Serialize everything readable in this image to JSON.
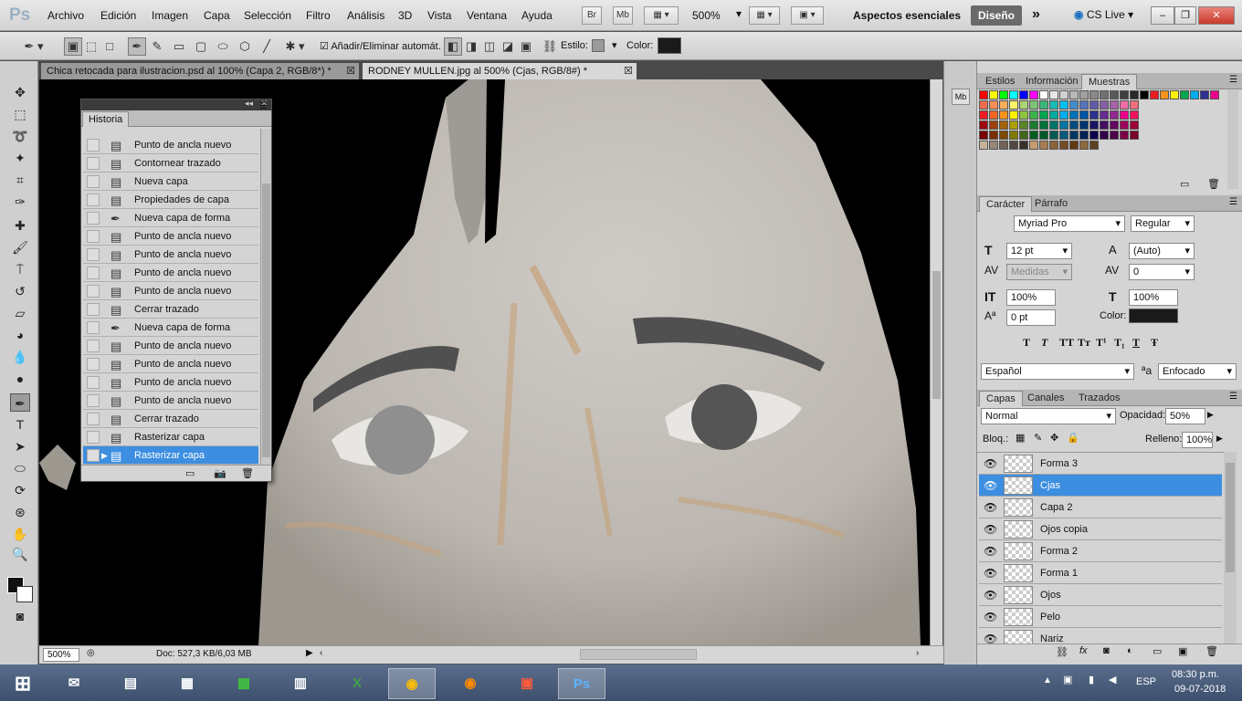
{
  "app": {
    "logo": "Ps"
  },
  "menu": [
    "Archivo",
    "Edición",
    "Imagen",
    "Capa",
    "Selección",
    "Filtro",
    "Análisis",
    "3D",
    "Vista",
    "Ventana",
    "Ayuda"
  ],
  "appbar": {
    "bridge": "Br",
    "minibridge": "Mb",
    "zoom": "500%",
    "workspace": "Aspectos esenciales",
    "workspace_active": "Diseño",
    "more": "»",
    "cslive": "CS Live"
  },
  "options": {
    "auto_add_delete": "Añadir/Eliminar automát.",
    "style_label": "Estilo:",
    "color_label": "Color:",
    "color_value": "#1a1a1a"
  },
  "tabs": [
    {
      "label": "Chica retocada para ilustracion.psd al 100% (Capa 2, RGB/8*) *",
      "active": false
    },
    {
      "label": "RODNEY MULLEN.jpg al 500% (Cjas, RGB/8#) *",
      "active": true
    }
  ],
  "history": {
    "title": "Historia",
    "items": [
      {
        "label": "Punto de ancla nuevo",
        "icon": "doc"
      },
      {
        "label": "Contornear trazado",
        "icon": "doc"
      },
      {
        "label": "Nueva capa",
        "icon": "doc"
      },
      {
        "label": "Propiedades de capa",
        "icon": "doc"
      },
      {
        "label": "Nueva capa de forma",
        "icon": "pen"
      },
      {
        "label": "Punto de ancla nuevo",
        "icon": "doc"
      },
      {
        "label": "Punto de ancla nuevo",
        "icon": "doc"
      },
      {
        "label": "Punto de ancla nuevo",
        "icon": "doc"
      },
      {
        "label": "Punto de ancla nuevo",
        "icon": "doc"
      },
      {
        "label": "Cerrar trazado",
        "icon": "doc"
      },
      {
        "label": "Nueva capa de forma",
        "icon": "pen"
      },
      {
        "label": "Punto de ancla nuevo",
        "icon": "doc"
      },
      {
        "label": "Punto de ancla nuevo",
        "icon": "doc"
      },
      {
        "label": "Punto de ancla nuevo",
        "icon": "doc"
      },
      {
        "label": "Punto de ancla nuevo",
        "icon": "doc"
      },
      {
        "label": "Cerrar trazado",
        "icon": "doc"
      },
      {
        "label": "Rasterizar capa",
        "icon": "doc"
      },
      {
        "label": "Rasterizar capa",
        "icon": "doc",
        "selected": true
      }
    ]
  },
  "status": {
    "zoom": "500%",
    "doc": "Doc: 527,3 KB/6,03 MB"
  },
  "swatches_panel": {
    "tabs": [
      "Estilos",
      "Información",
      "Muestras"
    ],
    "active": 2
  },
  "swatch_colors": [
    "#ff0000",
    "#ffff00",
    "#00ff00",
    "#00ffff",
    "#0000ff",
    "#ff00ff",
    "#ffffff",
    "#e8e8e8",
    "#d0d0d0",
    "#b8b8b8",
    "#a0a0a0",
    "#888888",
    "#707070",
    "#585858",
    "#404040",
    "#282828",
    "#000000",
    "#ed1c24",
    "#f7941d",
    "#fff200",
    "#00a651",
    "#00aeef",
    "#2e3192",
    "#ec008c",
    "#f26c4f",
    "#f68e55",
    "#fbaf5c",
    "#fff467",
    "#acd372",
    "#7cc576",
    "#3bb878",
    "#1abbb4",
    "#00bff3",
    "#438cca",
    "#5574b9",
    "#605ca8",
    "#855fa8",
    "#a763a8",
    "#f06ea9",
    "#f26d7d",
    "#ed1c24",
    "#f26522",
    "#f7941d",
    "#fff200",
    "#8dc63f",
    "#39b54a",
    "#00a651",
    "#00a99d",
    "#00aeef",
    "#0072bc",
    "#0054a6",
    "#2e3192",
    "#662d91",
    "#92278f",
    "#ec008c",
    "#ed145b",
    "#9e0b0f",
    "#a0410d",
    "#a36209",
    "#aba000",
    "#598527",
    "#1a7b30",
    "#007236",
    "#00746b",
    "#0076a3",
    "#004b80",
    "#003471",
    "#1b1464",
    "#440e62",
    "#630460",
    "#9e005d",
    "#9e0039",
    "#790000",
    "#7b2e00",
    "#7d4900",
    "#827b00",
    "#406618",
    "#005e20",
    "#005826",
    "#005952",
    "#005b7f",
    "#003663",
    "#002157",
    "#0d004c",
    "#32004b",
    "#4b0049",
    "#7b0046",
    "#7a0026",
    "#c7b299",
    "#998675",
    "#736357",
    "#534741",
    "#37302a",
    "#c69c6d",
    "#a67c52",
    "#8c6239",
    "#754c24",
    "#603913",
    "#8b6a3e",
    "#5e4322"
  ],
  "character_panel": {
    "tabs": [
      "Carácter",
      "Párrafo"
    ],
    "active": 0,
    "font_family": "Myriad Pro",
    "font_style": "Regular",
    "size": "12 pt",
    "leading": "(Auto)",
    "kerning": "Medidas",
    "tracking": "0",
    "vscale": "100%",
    "hscale": "100%",
    "baseline": "0 pt",
    "color_label": "Color:",
    "color_value": "#1a1a1a",
    "type_buttons": [
      "T",
      "T",
      "TT",
      "Tт",
      "T¹",
      "T₁",
      "T",
      "Ŧ"
    ],
    "language": "Español",
    "aa_label": "ªa",
    "antialias": "Enfocado"
  },
  "layers_panel": {
    "tabs": [
      "Capas",
      "Canales",
      "Trazados"
    ],
    "active": 0,
    "blend_mode": "Normal",
    "opacity_label": "Opacidad:",
    "opacity": "50%",
    "lock_label": "Bloq.:",
    "fill_label": "Relleno:",
    "fill": "100%",
    "layers": [
      {
        "name": "Forma 3",
        "selected": false
      },
      {
        "name": "Cjas",
        "selected": true
      },
      {
        "name": "Capa 2",
        "selected": false
      },
      {
        "name": "Ojos copia",
        "selected": false
      },
      {
        "name": "Forma 2",
        "selected": false
      },
      {
        "name": "Forma 1",
        "selected": false
      },
      {
        "name": "Ojos",
        "selected": false
      },
      {
        "name": "Pelo",
        "selected": false
      },
      {
        "name": "Nariz",
        "selected": false
      }
    ]
  },
  "taskbar": {
    "lang": "ESP",
    "time": "08:30 p.m.",
    "date": "09-07-2018",
    "active_app": "Ps"
  }
}
